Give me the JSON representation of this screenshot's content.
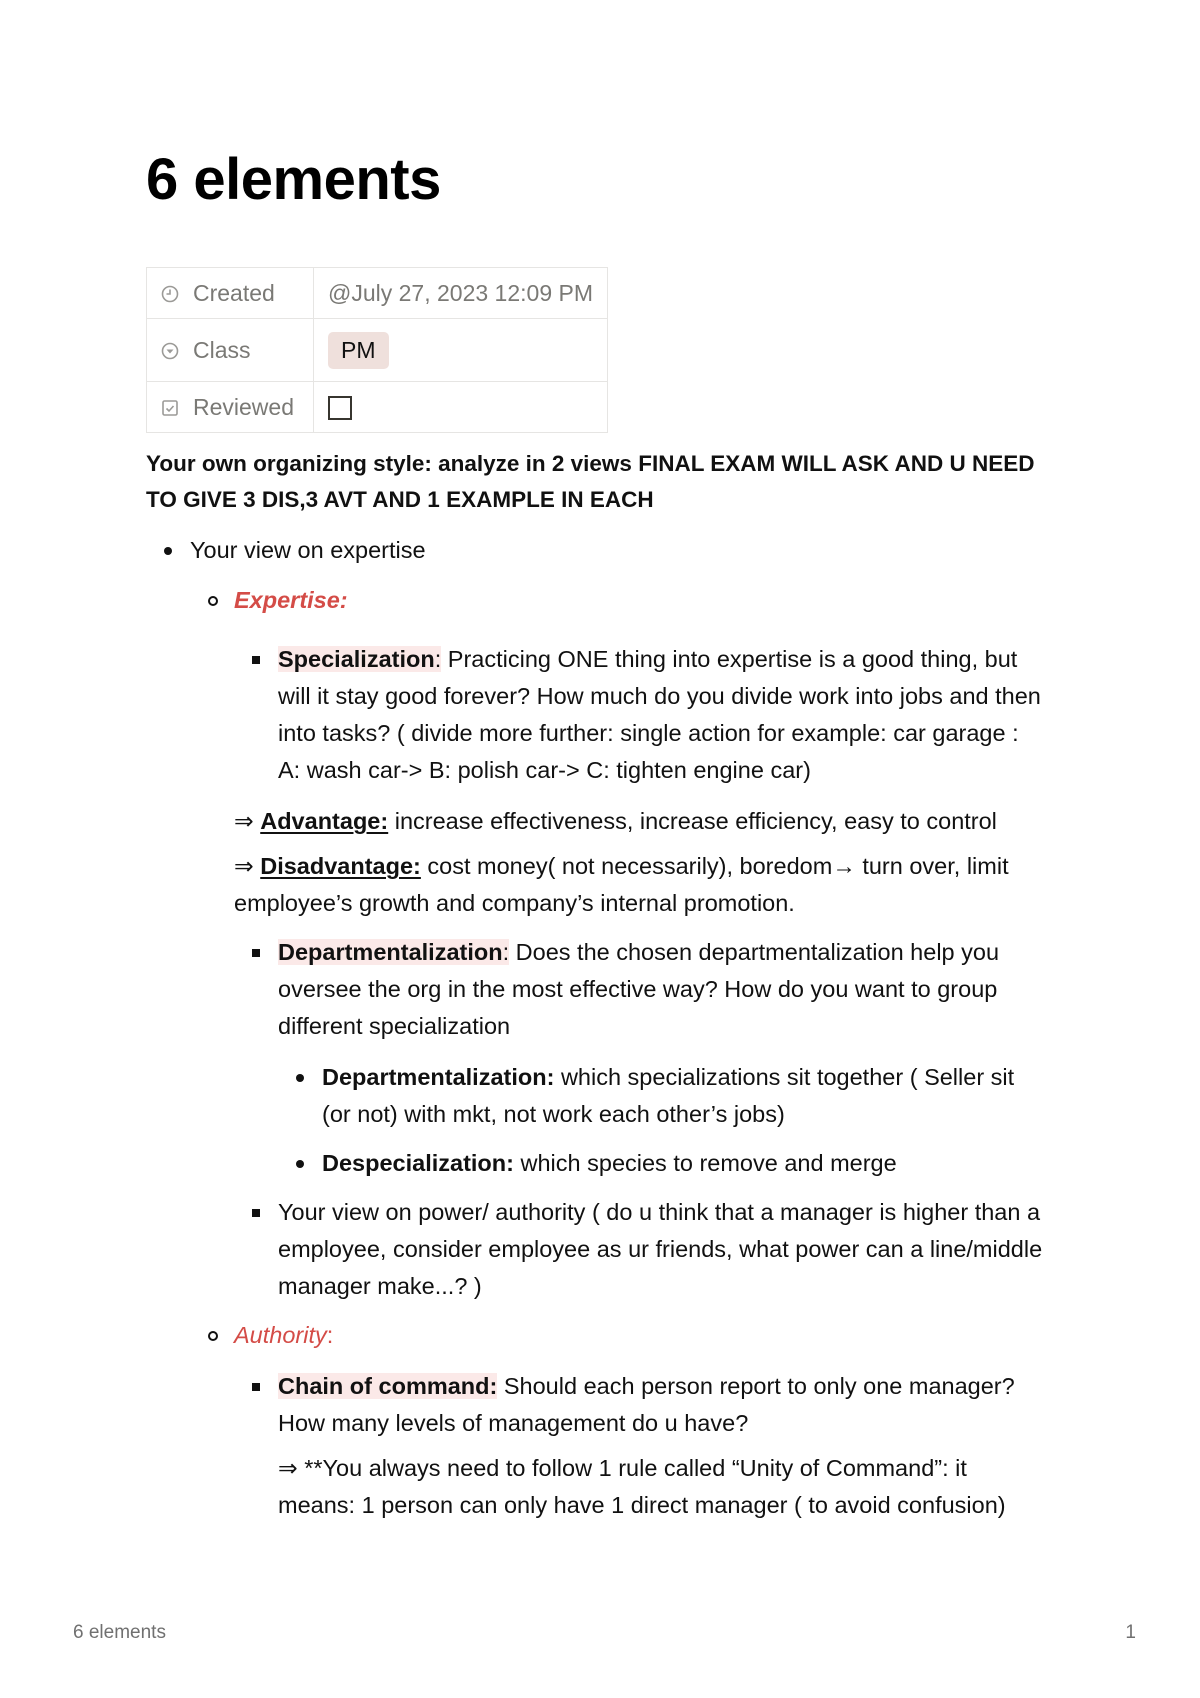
{
  "page": {
    "title": "6 elements"
  },
  "properties": [
    {
      "icon": "clock-icon",
      "label": "Created",
      "value": "@July 27, 2023 12:09 PM"
    },
    {
      "icon": "select-icon",
      "label": "Class",
      "value": "PM"
    },
    {
      "icon": "checkbox-icon",
      "label": "Reviewed",
      "value": false
    }
  ],
  "colors": {
    "accent_red": "#d44c47",
    "highlight_bg": "#fbe9e8",
    "tag_bg": "#efe0dc",
    "muted_text": "#7a7975"
  },
  "content": {
    "intro": "Your own organizing style: analyze in 2 views FINAL EXAM WILL ASK AND U NEED TO GIVE 3 DIS,3 AVT AND 1 EXAMPLE IN EACH",
    "view_expertise": "Your view on expertise",
    "expertise_heading": "Expertise:",
    "specialization": {
      "term": "Specialization",
      "colon": ":",
      "text": " Practicing ONE thing into expertise is a good thing, but will it stay good forever? How much do you divide work into jobs and then into tasks? ( divide more further: single action for example: car garage : A: wash car-> B: polish car-> C: tighten engine car)"
    },
    "advantage": {
      "arrow": "⇒ ",
      "term": "Advantage:",
      "text": " increase effectiveness, increase efficiency, easy to control"
    },
    "disadvantage": {
      "arrow": "⇒ ",
      "term": "Disadvantage:",
      "text": " cost money( not necessarily), boredom→ turn over, limit employee’s growth and company’s internal promotion."
    },
    "departmentalization": {
      "term": "Departmentalization",
      "colon": ":",
      "text": " Does the chosen departmentalization help you oversee the org in the most effective way? How do you want to group different specialization"
    },
    "dept_sub": {
      "term": "Departmentalization:",
      "text": " which specializations sit together ( Seller sit (or not) with mkt, not work each other’s jobs)"
    },
    "despec_sub": {
      "term": "Despecialization:",
      "text": " which species to remove and merge"
    },
    "view_power": "Your view on power/ authority ( do u think that a manager is higher than a employee, consider employee as ur friends, what power can a line/middle manager make...? )",
    "authority_heading": "Authority",
    "authority_colon": ":",
    "chain_of_command": {
      "term": "Chain of command:",
      "text": " Should each person report to only one manager? How many levels of management do u have?"
    },
    "unity_note": "⇒ **You always need to follow 1 rule called “Unity of Command”: it means: 1 person can only have 1 direct manager ( to avoid confusion)"
  },
  "footer": {
    "doc_name": "6 elements",
    "page_number": "1"
  }
}
